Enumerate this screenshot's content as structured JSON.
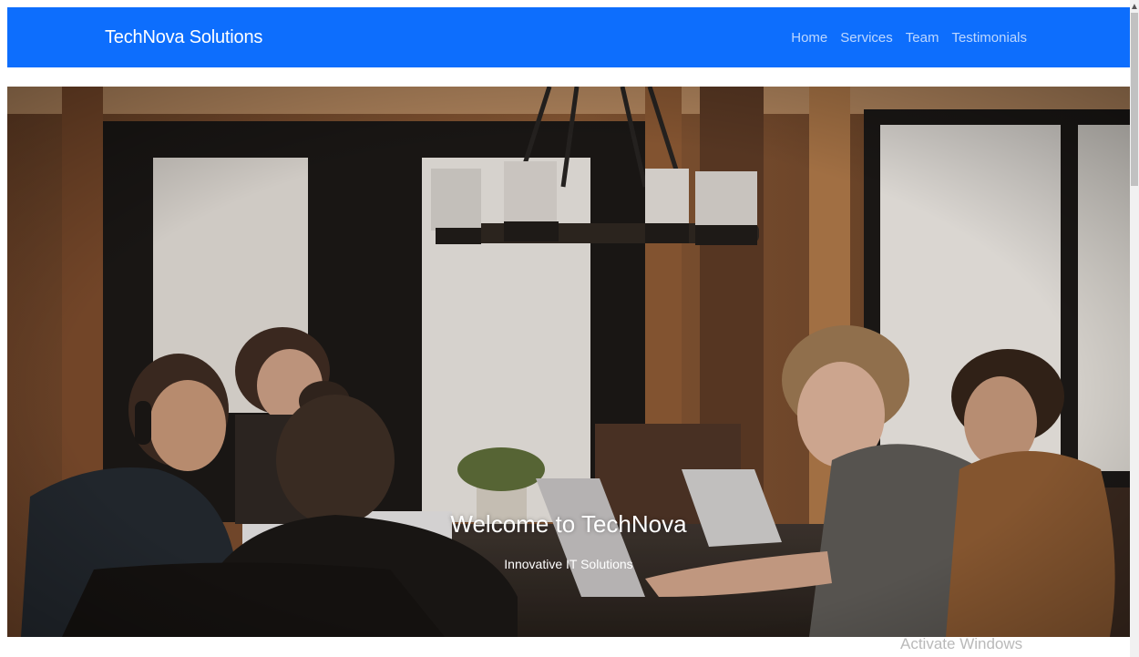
{
  "navbar": {
    "brand": "TechNova Solutions",
    "links": [
      "Home",
      "Services",
      "Team",
      "Testimonials"
    ],
    "background": "#0d6efd"
  },
  "hero": {
    "title": "Welcome to TechNova",
    "subtitle": "Innovative IT Solutions"
  },
  "watermark": {
    "text": "Activate Windows"
  }
}
